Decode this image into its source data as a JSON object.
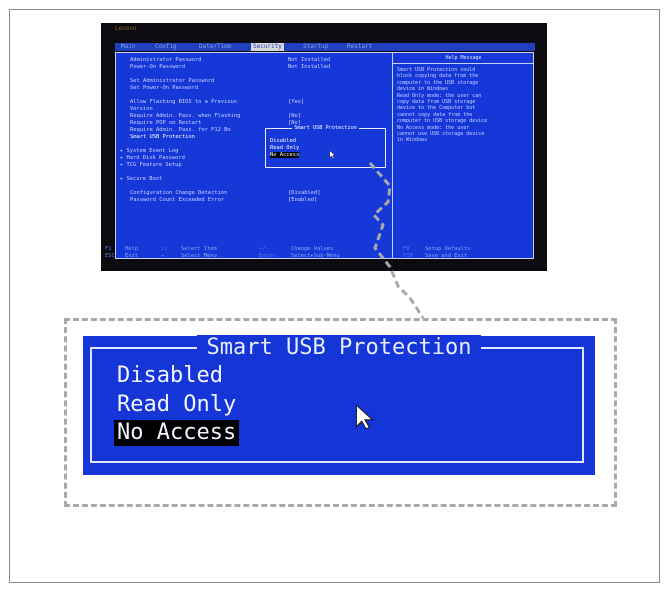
{
  "bios": {
    "brand": "Lenovo",
    "menu_tabs": [
      "Main",
      "Config",
      "Date/Time",
      "Security",
      "Startup",
      "Restart"
    ],
    "active_tab": "Security",
    "help_header": "Help Message",
    "items": [
      {
        "label": "Administrator Password",
        "value": "Not Installed"
      },
      {
        "label": "Power-On Password",
        "value": "Not Installed"
      },
      {
        "label": "Set Administrator Password",
        "value": ""
      },
      {
        "label": "Set Power-On Password",
        "value": ""
      },
      {
        "label": "Allow Flashing BIOS to a Previous",
        "value": "[Yes]"
      },
      {
        "label": "Version",
        "value": ""
      },
      {
        "label": "Require Admin. Pass. when Flashing",
        "value": "[No]"
      },
      {
        "label": "Require POP on Restart",
        "value": "[No]"
      },
      {
        "label": "Require Admin. Pass. for F12 Bo",
        "value": ""
      },
      {
        "label": "Smart USB Protection",
        "value": ""
      },
      {
        "label": "▸ System Event Log",
        "value": ""
      },
      {
        "label": "▸ Hard Disk Password",
        "value": ""
      },
      {
        "label": "▸ TCG Feature Setup",
        "value": ""
      },
      {
        "label": "▸ Secure Boot",
        "value": ""
      },
      {
        "label": "Configuration Change Detection",
        "value": "[Disabled]"
      },
      {
        "label": "Password Count Exceeded Error",
        "value": "[Enabled]"
      }
    ],
    "help_lines": [
      "Smart USB Protection could",
      "block copying data from the",
      "computer to the USB storage",
      "device in Windows",
      "Read Only mode: the user can",
      "copy data from USB storage",
      "device to the Computer but",
      "cannot copy data from the",
      "computer to USB storage device",
      "No Access mode: the user",
      "cannot use USB storage device",
      "in Windows"
    ],
    "footer": {
      "f1_key": "F1",
      "f1_label": "Help",
      "esc_key": "ESC",
      "esc_label": "Exit",
      "updown_key": "↑↓",
      "updown_label": "Select Item",
      "lr_key": "↔",
      "lr_label": "Select Menu",
      "pm_key": "+/-",
      "pm_label": "Change Values",
      "enter_key": "Enter",
      "enter_label": "Select▸Sub-Menu",
      "f9_key": "F9",
      "f9_label": "Setup Defaults",
      "f10_key": "F10",
      "f10_label": "Save and Exit"
    }
  },
  "popup": {
    "title": "Smart USB Protection",
    "options": [
      "Disabled",
      "Read Only",
      "No Access"
    ],
    "selected": "No Access"
  },
  "colors": {
    "bios_blue": "#1738d8",
    "highlight": "#000000",
    "callout_dash": "#a9a9a9"
  }
}
